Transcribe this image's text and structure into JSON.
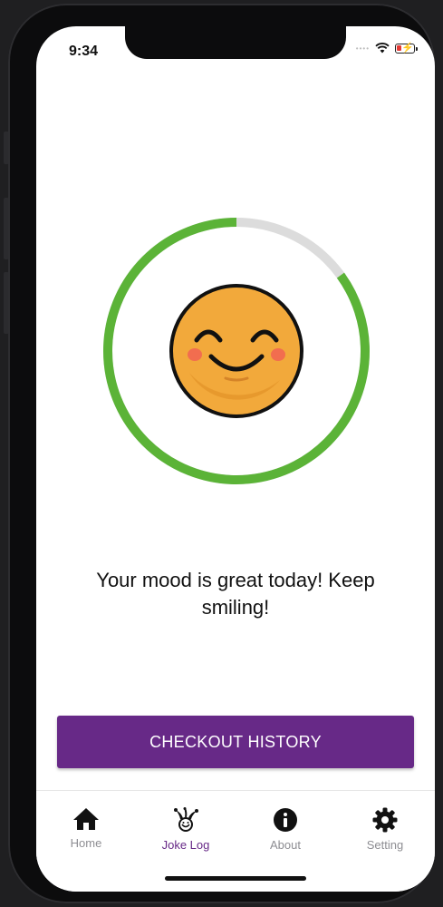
{
  "status_bar": {
    "time": "9:34"
  },
  "mood": {
    "message": "Your mood is great today! Keep smiling!",
    "progress": 0.85
  },
  "actions": {
    "history_button": "CHECKOUT HISTORY"
  },
  "tabs": [
    {
      "label": "Home",
      "icon": "home-icon",
      "active": false
    },
    {
      "label": "Joke Log",
      "icon": "jester-icon",
      "active": true
    },
    {
      "label": "About",
      "icon": "info-icon",
      "active": false
    },
    {
      "label": "Setting",
      "icon": "gear-icon",
      "active": false
    }
  ],
  "colors": {
    "accent": "#672987",
    "progress": "#5bb337",
    "track": "#dcdcdc",
    "face": "#f2a93b",
    "cheeks": "#f26d4f"
  }
}
